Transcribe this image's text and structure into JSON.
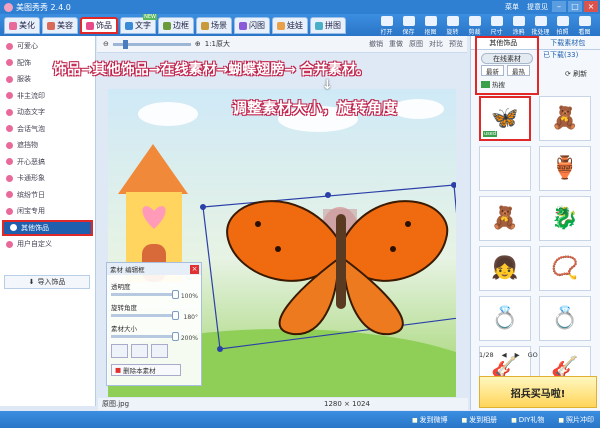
{
  "app": {
    "title": "美图秀秀 2.4.0",
    "links": [
      "菜单",
      "提意见"
    ]
  },
  "tabs": [
    {
      "label": "美化",
      "color": "#e86a9a"
    },
    {
      "label": "美容",
      "color": "#d86a5a"
    },
    {
      "label": "饰品",
      "color": "#e84a8a",
      "active": true
    },
    {
      "label": "文字",
      "color": "#3a8ad8",
      "badge": "NEW"
    },
    {
      "label": "边框",
      "color": "#6a9a3a"
    },
    {
      "label": "场景",
      "color": "#c89a3a"
    },
    {
      "label": "闪图",
      "color": "#8a5ad8"
    },
    {
      "label": "娃娃",
      "color": "#e8a04a"
    },
    {
      "label": "拼图",
      "color": "#4ab0c8"
    }
  ],
  "right_tools": [
    "打开",
    "保存",
    "抠图",
    "旋转",
    "剪裁",
    "尺寸",
    "涂鸦",
    "批处理",
    "拍照",
    "看图"
  ],
  "categories": [
    "可爱心",
    "配饰",
    "服装",
    "非主流印",
    "动态文字",
    "会话气泡",
    "遮挡物",
    "开心恶搞",
    "卡通形象",
    "缤纷节日",
    "闲宝专用",
    "其他饰品",
    "用户自定义"
  ],
  "selected_category_index": 11,
  "import_label": "导入饰品",
  "canvas_bar": {
    "zoom": "1:1原大",
    "undo": "撤销",
    "redo": "重做",
    "original": "原图",
    "compare": "对比",
    "preview": "预览"
  },
  "annotation": {
    "steps": [
      "饰品",
      "其他饰品",
      "在线素材",
      "蝴蝶翅膀",
      "合并素材。"
    ],
    "sub": "调整素材大小，旋转角度"
  },
  "edit_panel": {
    "title": "素材 编辑框",
    "rows": [
      {
        "label": "透明度",
        "value": "100%"
      },
      {
        "label": "旋转角度",
        "value": "180°"
      },
      {
        "label": "素材大小",
        "value": "200%"
      }
    ],
    "delete_label": "删除本素材"
  },
  "status": {
    "filename": "原图.jpg",
    "dims": "1280 × 1024"
  },
  "side_panel": {
    "tabs": [
      "其他饰品",
      "下载素材包"
    ],
    "downloaded": "已下载(33)",
    "source_chip": "在线素材",
    "sort": [
      "最新",
      "最热"
    ],
    "hot_label": "热搜",
    "refresh": "刷新",
    "thumbs": [
      "🦋",
      "🧸",
      "",
      "🏺",
      "🧸",
      "🐉",
      "👧",
      "📿",
      "💍",
      "💍",
      "🎸",
      "🎸"
    ],
    "thumb_selected_index": 0,
    "used_tag": "used",
    "pager": [
      "1/28",
      "◀",
      "▶",
      "GO"
    ],
    "ad": "招兵买马啦!"
  },
  "bottom": [
    "发到微博",
    "发到相册",
    "DIY礼物",
    "照片冲印"
  ]
}
